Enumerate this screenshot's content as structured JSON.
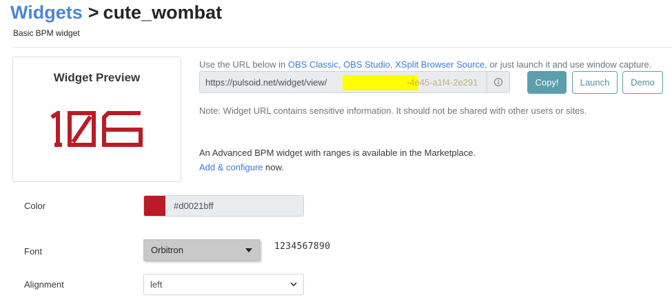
{
  "breadcrumb": {
    "parent": "Widgets",
    "separator": ">",
    "current": "cute_wombat"
  },
  "subtitle": "Basic BPM widget",
  "preview": {
    "title": "Widget Preview",
    "bpm": "106",
    "color": "#b91c24"
  },
  "instructions": {
    "prefix": "Use the URL below in ",
    "link1": "OBS Classic",
    "sep1": ", ",
    "link2": "OBS Studio",
    "sep2": ", ",
    "link3": "XSplit Browser Source",
    "suffix": ", or just launch it and use window capture."
  },
  "url": {
    "visible_start": "https://pulsoid.net/widget/view/",
    "visible_tail": "-4e45-a1f4-2e291",
    "info_icon": "info-circle-icon"
  },
  "buttons": {
    "copy": "Copy!",
    "launch": "Launch",
    "demo": "Demo"
  },
  "note": "Note: Widget URL contains sensitive information. It should not be shared with other users or sites.",
  "advanced": {
    "text": "An Advanced BPM widget with ranges is available in the Marketplace.",
    "link": "Add & configure",
    "suffix": " now."
  },
  "form": {
    "color_label": "Color",
    "color_value": "#d0021bff",
    "font_label": "Font",
    "font_value": "Orbitron",
    "font_sample": "1234567890",
    "alignment_label": "Alignment",
    "alignment_value": "left"
  },
  "colors": {
    "accent": "#5b9eac",
    "link": "#3a7bd5",
    "bpm": "#b91c24"
  }
}
